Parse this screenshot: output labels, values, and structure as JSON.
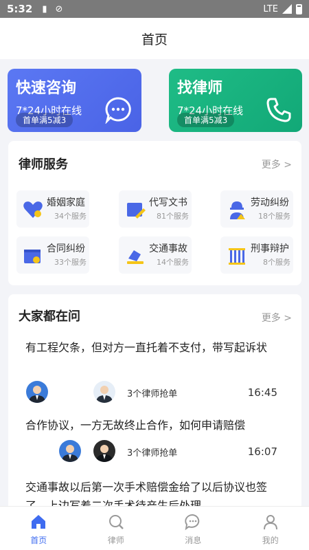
{
  "status_bar": {
    "time": "5:32",
    "network": "LTE"
  },
  "header": {
    "title": "首页"
  },
  "quick_consult": {
    "title": "快速咨询",
    "subtitle": "7*24小时在线",
    "badge": "首单满5减3",
    "icon": "chat-bubble-icon"
  },
  "find_lawyer": {
    "title": "找律师",
    "subtitle": "7*24小时在线",
    "badge": "首单满5减3",
    "icon": "phone-icon"
  },
  "lawyer_services": {
    "title": "律师服务",
    "more": "更多 >",
    "items": [
      {
        "name": "婚姻家庭",
        "count": "34个服务",
        "icon": "heart-icon"
      },
      {
        "name": "代写文书",
        "count": "81个服务",
        "icon": "document-pen-icon"
      },
      {
        "name": "劳动纠纷",
        "count": "18个服务",
        "icon": "worker-icon"
      },
      {
        "name": "合同纠纷",
        "count": "33个服务",
        "icon": "contract-icon"
      },
      {
        "name": "交通事故",
        "count": "14个服务",
        "icon": "car-accident-icon"
      },
      {
        "name": "刑事辩护",
        "count": "8个服务",
        "icon": "prison-bars-icon"
      }
    ]
  },
  "questions": {
    "title": "大家都在问",
    "more": "更多 >",
    "items": [
      {
        "text": "有工程欠条，但对方一直托着不支付，带写起诉状",
        "meta": "3个律师抢单",
        "time": "16:45"
      },
      {
        "text": "合作协议，一方无故终止合作，如何申请赔偿",
        "meta": "3个律师抢单",
        "time": "16:07"
      },
      {
        "text": "交通事故以后第一次手术赔偿金给了以后协议也签了，上边写着二次手术待产生后处理，",
        "meta": "",
        "time": ""
      }
    ]
  },
  "tabbar": {
    "tabs": [
      {
        "label": "首页",
        "icon": "home-icon"
      },
      {
        "label": "律师",
        "icon": "lawyer-search-icon"
      },
      {
        "label": "消息",
        "icon": "message-icon"
      },
      {
        "label": "我的",
        "icon": "profile-icon"
      }
    ]
  },
  "colors": {
    "primary": "#4a63e6",
    "green": "#12a877",
    "active_tab": "#3f6cf0"
  }
}
